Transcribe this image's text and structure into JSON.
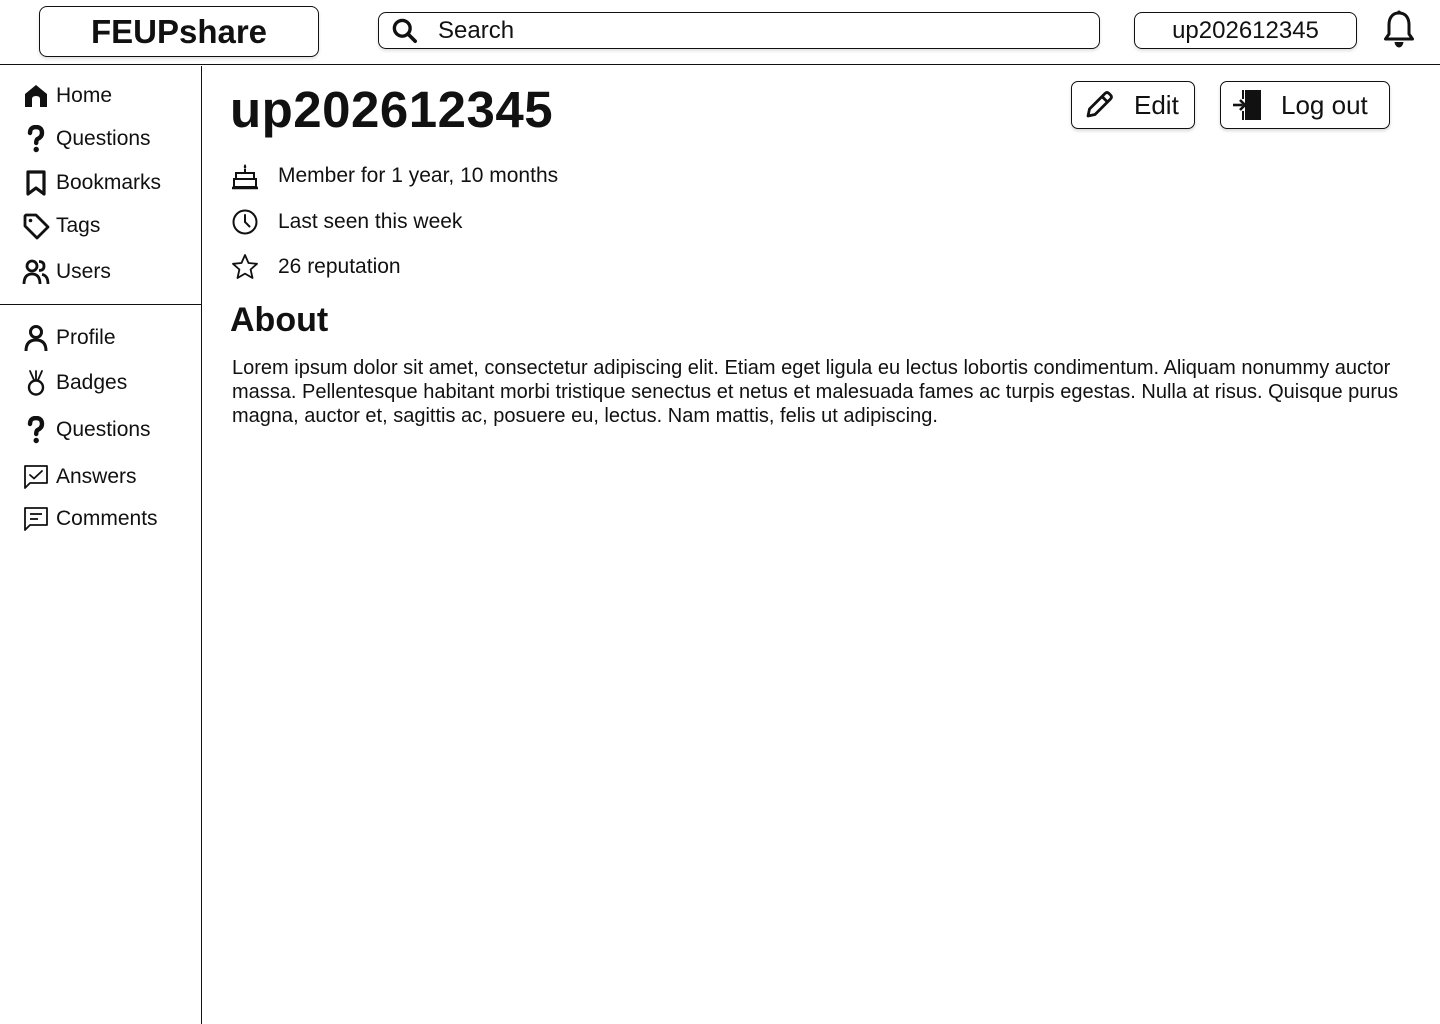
{
  "header": {
    "logo": "FEUPshare",
    "search_placeholder": "Search",
    "username": "up202612345"
  },
  "sidebar": {
    "nav": [
      {
        "label": "Home",
        "icon": "home-icon"
      },
      {
        "label": "Questions",
        "icon": "question-mark-icon"
      },
      {
        "label": "Bookmarks",
        "icon": "bookmark-icon"
      },
      {
        "label": "Tags",
        "icon": "tag-icon"
      },
      {
        "label": "Users",
        "icon": "users-icon"
      }
    ],
    "profile_nav": [
      {
        "label": "Profile",
        "icon": "person-icon"
      },
      {
        "label": "Badges",
        "icon": "medal-icon"
      },
      {
        "label": "Questions",
        "icon": "question-mark-icon"
      },
      {
        "label": "Answers",
        "icon": "answer-check-icon"
      },
      {
        "label": "Comments",
        "icon": "comment-icon"
      }
    ]
  },
  "profile": {
    "username": "up202612345",
    "edit_label": "Edit",
    "logout_label": "Log out",
    "stats": {
      "member": "Member for 1 year, 10 months",
      "last_seen": "Last seen this week",
      "reputation": "26 reputation"
    },
    "about_heading": "About",
    "about_text": "Lorem ipsum dolor sit amet, consectetur adipiscing elit. Etiam eget  ligula eu lectus lobortis condimentum. Aliquam nonummy auctor massa.  Pellentesque habitant morbi tristique senectus et netus et malesuada  fames ac turpis egestas. Nulla at risus. Quisque purus magna, auctor et, sagittis ac, posuere eu, lectus. Nam mattis, felis ut adipiscing."
  }
}
